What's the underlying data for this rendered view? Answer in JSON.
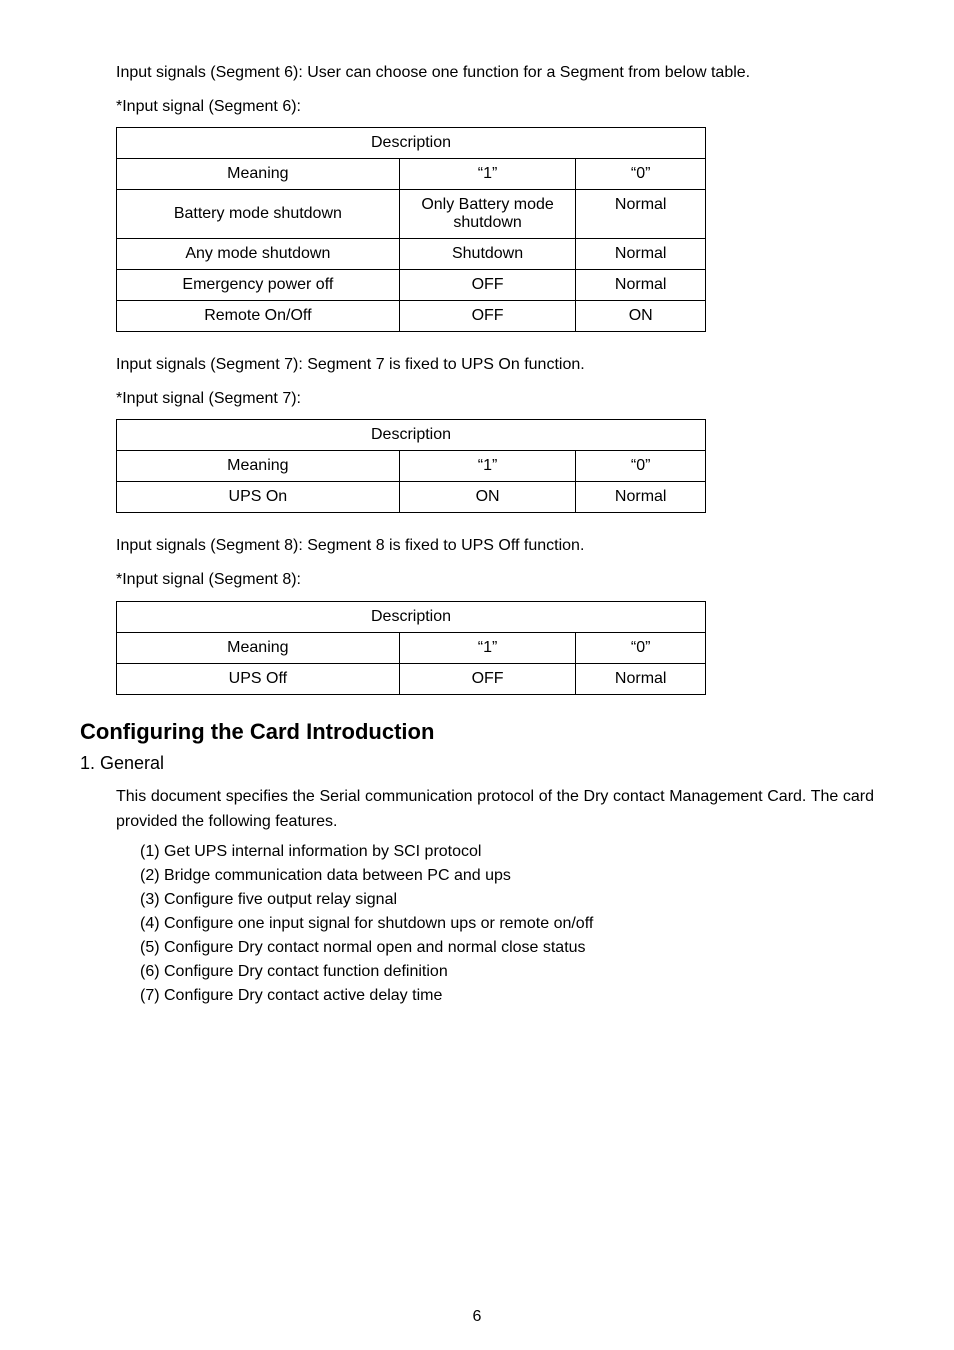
{
  "p1": "Input signals (Segment 6): User can choose one function for a Segment from below table.",
  "p2": "*Input signal (Segment 6):",
  "t1": {
    "header": "Description",
    "row0": {
      "c0": "Meaning",
      "c1": "“1”",
      "c2": "“0”"
    },
    "row1": {
      "c0": "Battery mode shutdown",
      "c1a": "Only Battery mode",
      "c1b": "shutdown",
      "c2": "Normal"
    },
    "row2": {
      "c0": "Any mode shutdown",
      "c1": "Shutdown",
      "c2": "Normal"
    },
    "row3": {
      "c0": "Emergency power off",
      "c1": "OFF",
      "c2": "Normal"
    },
    "row4": {
      "c0": "Remote On/Off",
      "c1": "OFF",
      "c2": "ON"
    }
  },
  "p3": "Input signals (Segment 7): Segment 7 is fixed to UPS On function.",
  "p4": "*Input signal (Segment 7):",
  "t2": {
    "header": "Description",
    "row0": {
      "c0": "Meaning",
      "c1": "“1”",
      "c2": "“0”"
    },
    "row1": {
      "c0": "UPS On",
      "c1": "ON",
      "c2": "Normal"
    }
  },
  "p5": " Input signals (Segment 8): Segment 8 is fixed to UPS Off function.",
  "p6": "*Input signal (Segment 8):",
  "t3": {
    "header": "Description",
    "row0": {
      "c0": "Meaning",
      "c1": "“1”",
      "c2": "“0”"
    },
    "row1": {
      "c0": "UPS Off",
      "c1": "OFF",
      "c2": "Normal"
    }
  },
  "h2": "Configuring the Card Introduction",
  "sub1": "1. General",
  "p7": "This document specifies the Serial communication protocol of the Dry contact Management Card. The card provided the following features.",
  "list": {
    "i1": "(1) Get UPS internal information by SCI protocol",
    "i2": "(2) Bridge communication data between PC and ups",
    "i3": "(3) Configure five output relay signal",
    "i4": "(4) Configure one input signal for shutdown ups or remote on/off",
    "i5": "(5) Configure Dry contact normal open and normal close status",
    "i6": "(6) Configure Dry contact function definition",
    "i7": "(7) Configure Dry contact active delay time"
  },
  "pagenum": "6"
}
